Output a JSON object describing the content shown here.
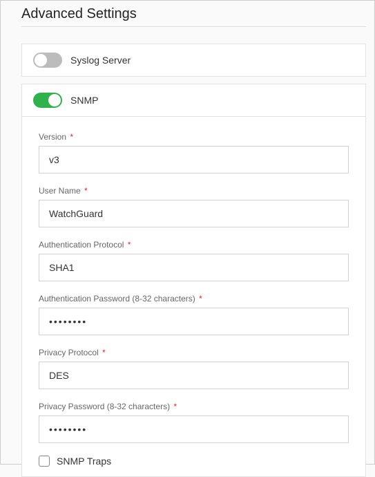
{
  "title": "Advanced Settings",
  "sections": {
    "syslog": {
      "label": "Syslog Server",
      "enabled": false
    },
    "snmp": {
      "label": "SNMP",
      "enabled": true
    }
  },
  "snmp_form": {
    "version": {
      "label": "Version",
      "value": "v3"
    },
    "username": {
      "label": "User Name",
      "value": "WatchGuard"
    },
    "auth_protocol": {
      "label": "Authentication Protocol",
      "value": "SHA1"
    },
    "auth_password": {
      "label": "Authentication Password (8-32 characters)",
      "value": "••••••••"
    },
    "privacy_protocol": {
      "label": "Privacy Protocol",
      "value": "DES"
    },
    "privacy_password": {
      "label": "Privacy Password (8-32 characters)",
      "value": "••••••••"
    },
    "traps": {
      "label": "SNMP Traps",
      "checked": false
    }
  },
  "required_marker": "*"
}
